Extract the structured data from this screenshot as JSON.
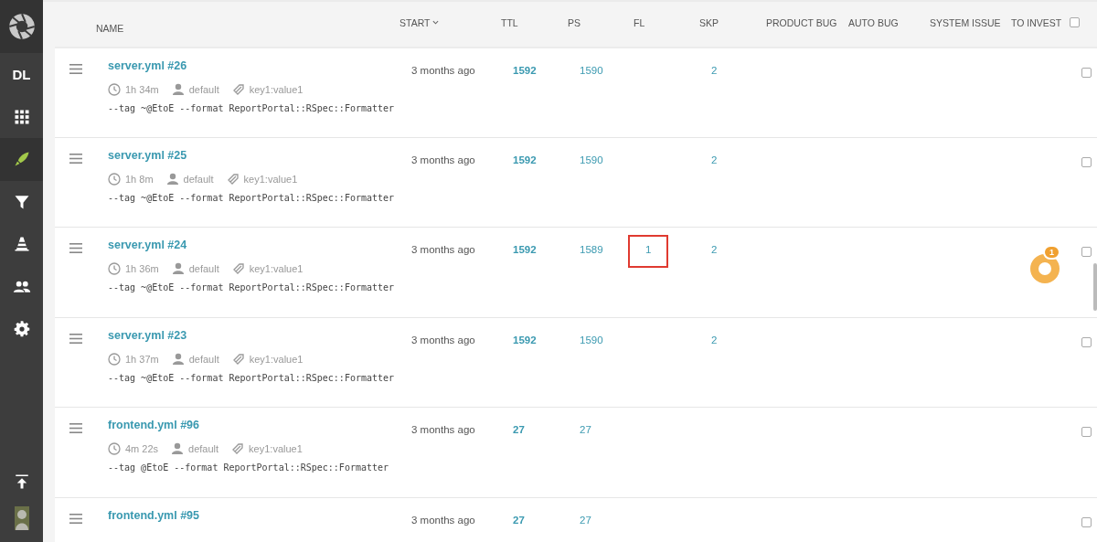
{
  "sidebar": {
    "items": [
      {
        "kind": "logo",
        "selected": false
      },
      {
        "kind": "project",
        "label": "DL",
        "selected": false
      },
      {
        "kind": "dashboards",
        "selected": false
      },
      {
        "kind": "launches",
        "selected": true
      },
      {
        "kind": "filters",
        "selected": false
      },
      {
        "kind": "debug",
        "selected": false
      },
      {
        "kind": "members",
        "selected": false
      },
      {
        "kind": "settings",
        "selected": false
      }
    ],
    "bottom": [
      {
        "kind": "top"
      },
      {
        "kind": "avatar"
      }
    ]
  },
  "table": {
    "columns": [
      {
        "label": "NAME"
      },
      {
        "label": "START",
        "sortable": true
      },
      {
        "label": "TTL"
      },
      {
        "label": "PS"
      },
      {
        "label": "FL"
      },
      {
        "label": "SKP"
      },
      {
        "label": "PRODUCT BUG"
      },
      {
        "label": "AUTO BUG"
      },
      {
        "label": "SYSTEM ISSUE"
      },
      {
        "label": "TO INVEST"
      }
    ],
    "select_all": {
      "checked": false
    },
    "rows": [
      {
        "name": "server.yml #26",
        "duration": "1h 34m",
        "owner": "default",
        "attribute": "key1:value1",
        "description": "--tag ~@EtoE --format ReportPortal::RSpec::Formatter",
        "start": "3 months ago",
        "ttl": "1592",
        "ps": "1590",
        "fl": null,
        "skp": "2",
        "to_invest": null,
        "checked": false
      },
      {
        "name": "server.yml #25",
        "duration": "1h 8m",
        "owner": "default",
        "attribute": "key1:value1",
        "description": "--tag ~@EtoE --format ReportPortal::RSpec::Formatter",
        "start": "3 months ago",
        "ttl": "1592",
        "ps": "1590",
        "fl": null,
        "skp": "2",
        "to_invest": null,
        "checked": false
      },
      {
        "name": "server.yml #24",
        "duration": "1h 36m",
        "owner": "default",
        "attribute": "key1:value1",
        "description": "--tag ~@EtoE --format ReportPortal::RSpec::Formatter",
        "start": "3 months ago",
        "ttl": "1592",
        "ps": "1589",
        "fl": "1",
        "fl_highlighted": true,
        "skp": "2",
        "to_invest": "1",
        "checked": false
      },
      {
        "name": "server.yml #23",
        "duration": "1h 37m",
        "owner": "default",
        "attribute": "key1:value1",
        "description": "--tag ~@EtoE --format ReportPortal::RSpec::Formatter",
        "start": "3 months ago",
        "ttl": "1592",
        "ps": "1590",
        "fl": null,
        "skp": "2",
        "to_invest": null,
        "checked": false
      },
      {
        "name": "frontend.yml #96",
        "duration": "4m 22s",
        "owner": "default",
        "attribute": "key1:value1",
        "description": "--tag @EtoE --format ReportPortal::RSpec::Formatter",
        "start": "3 months ago",
        "ttl": "27",
        "ps": "27",
        "fl": null,
        "skp": null,
        "to_invest": null,
        "checked": false
      },
      {
        "name": "frontend.yml #95",
        "start": "3 months ago",
        "ttl": "27",
        "ps": "27",
        "fl": null,
        "skp": null,
        "to_invest": null,
        "checked": false
      }
    ]
  }
}
